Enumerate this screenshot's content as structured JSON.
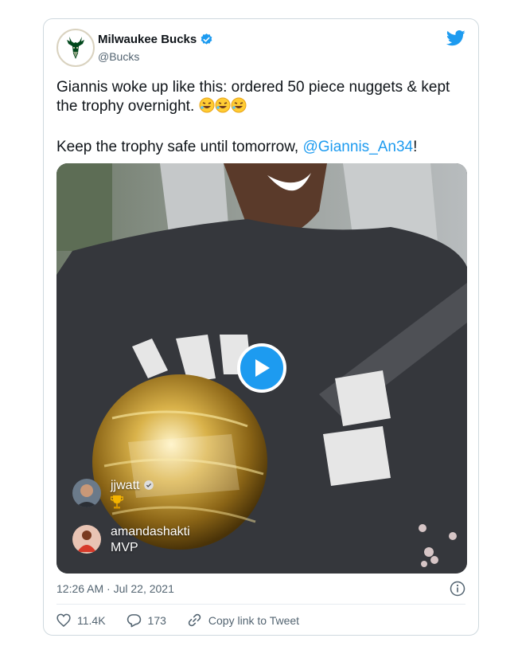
{
  "account": {
    "display_name": "Milwaukee Bucks",
    "handle": "@Bucks",
    "verified": true,
    "logo_icon": "bucks-deer-logo"
  },
  "tweet": {
    "line1_text": "Giannis woke up like this: ordered 50 piece nuggets & kept the trophy overnight. ",
    "emojis": [
      "rolling-on-floor-laughing",
      "rolling-on-floor-laughing",
      "rolling-on-floor-laughing"
    ],
    "line2_prefix": "Keep the trophy safe until tomorrow, ",
    "mention": "@Giannis_An34",
    "line2_suffix": "!"
  },
  "media": {
    "type": "video",
    "play_icon": "play-icon",
    "live_comments": [
      {
        "user": "jjwatt",
        "message_icon": "trophy-icon",
        "verified": true
      },
      {
        "user": "amandashakti",
        "message": "MVP"
      }
    ]
  },
  "meta": {
    "timestamp": "12:26 AM · Jul 22, 2021"
  },
  "actions": {
    "likes": "11.4K",
    "replies": "173",
    "copy_link": "Copy link to Tweet"
  },
  "colors": {
    "accent": "#1d9bf0",
    "text_primary": "#0f1419",
    "text_secondary": "#536471",
    "border": "#cfd9de",
    "bucks_green": "#00471b"
  }
}
